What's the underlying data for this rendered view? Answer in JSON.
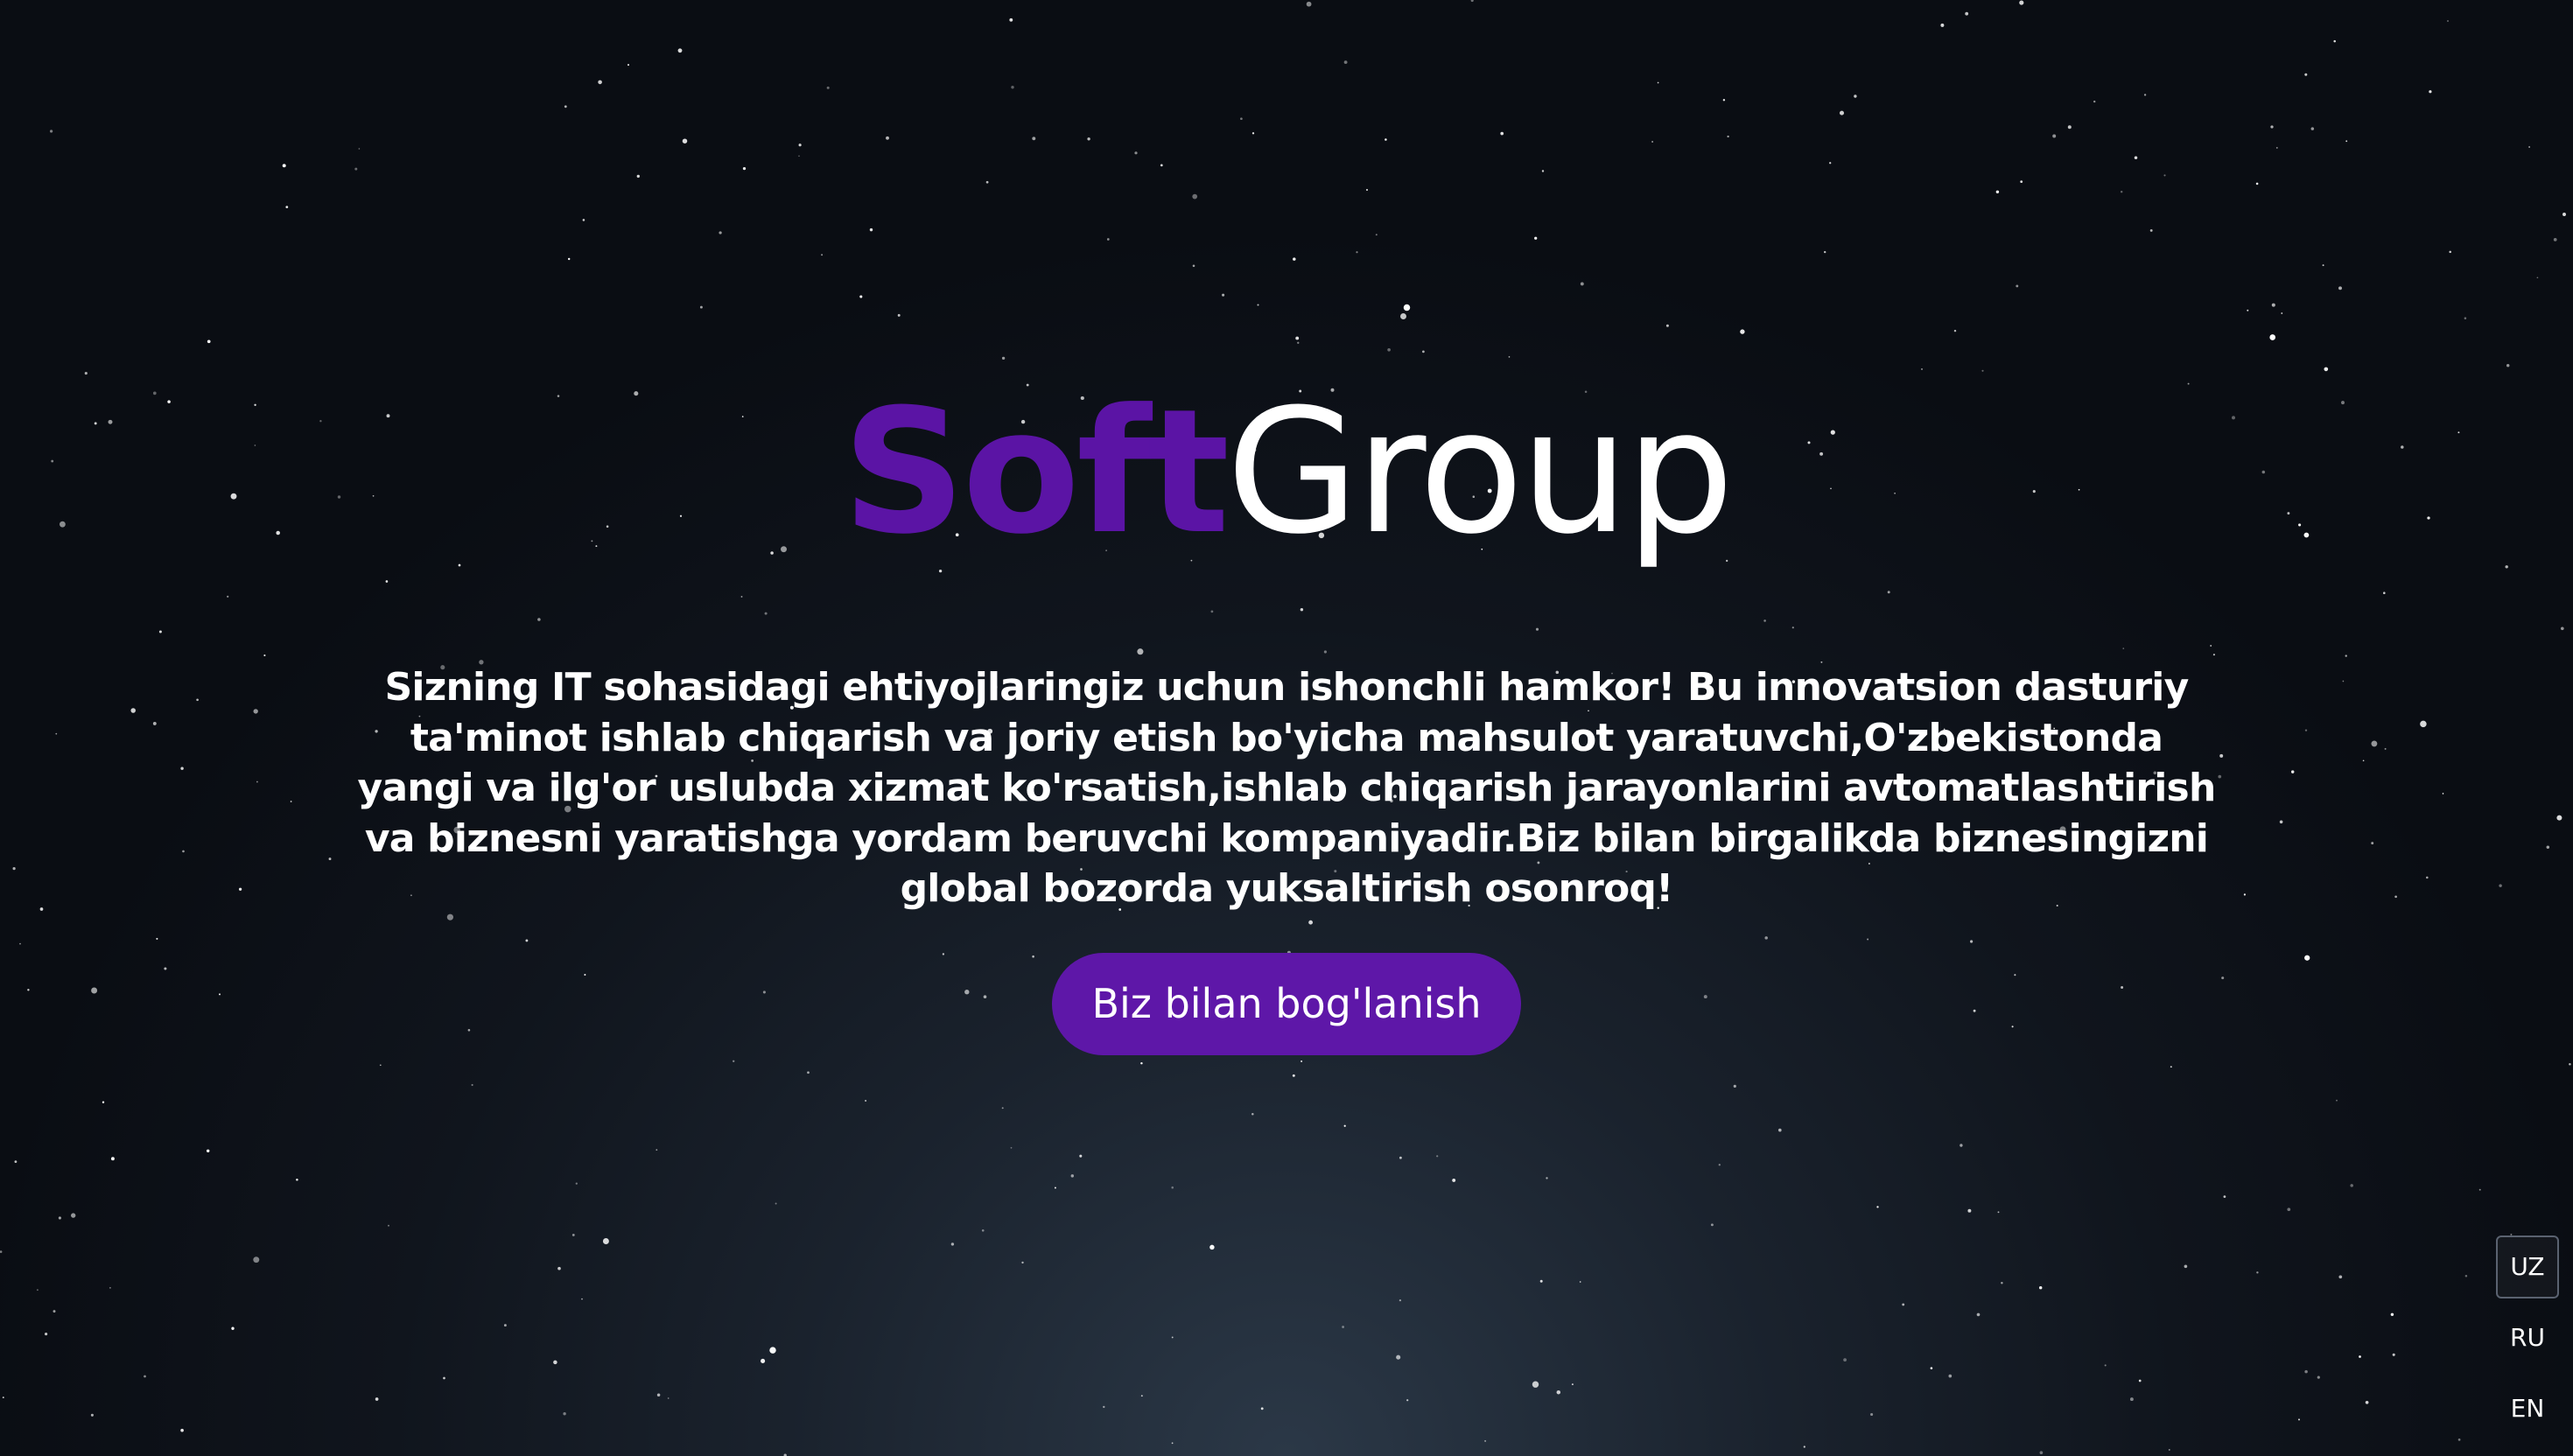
{
  "brand": {
    "part1": "Soft",
    "part2": "Group",
    "part1_color": "#5b14a5",
    "part2_color": "#ffffff"
  },
  "hero": {
    "tagline": "Sizning IT sohasidagi ehtiyojlaringiz uchun ishonchli hamkor! Bu innovatsion dasturiy ta'minot ishlab chiqarish va joriy etish bo'yicha mahsulot yaratuvchi,O'zbekistonda yangi va ilg'or uslubda xizmat ko'rsatish,ishlab chiqarish jarayonlarini avtomatlashtirish va biznesni yaratishga yordam beruvchi kompaniyadir.Biz bilan birgalikda biznesingizni global bozorda yuksaltirish osonroq!",
    "cta_label": "Biz bilan bog'lanish",
    "cta_color": "#5e17a8"
  },
  "languages": {
    "items": [
      "UZ",
      "RU",
      "EN"
    ],
    "active": "UZ"
  },
  "background": {
    "top_color": "#0a0d13",
    "glow_color": "#2b3847",
    "star_color": "#ffffff"
  }
}
